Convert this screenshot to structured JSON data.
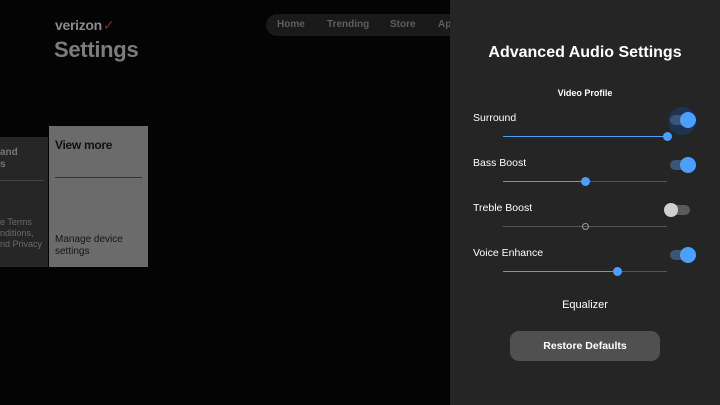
{
  "app": {
    "logo": "verizon",
    "logo_mark": "✓",
    "title": "Settings"
  },
  "nav": {
    "items": [
      "Home",
      "Trending",
      "Store",
      "Ap"
    ]
  },
  "cards": {
    "left_partial": {
      "title": "and\ns",
      "desc": "e Terms\nnditions,\nnd Privacy"
    },
    "view_more": {
      "title": "View more",
      "desc": "Manage device settings"
    }
  },
  "panel": {
    "title": "Advanced Audio Settings",
    "profile": "Video Profile",
    "settings": [
      {
        "label": "Surround",
        "enabled": true,
        "level": 1.0
      },
      {
        "label": "Bass Boost",
        "enabled": true,
        "level": 0.5
      },
      {
        "label": "Treble Boost",
        "enabled": false,
        "level": 0.5
      },
      {
        "label": "Voice Enhance",
        "enabled": true,
        "level": 0.7
      }
    ],
    "equalizer": "Equalizer",
    "restore": "Restore Defaults"
  },
  "colors": {
    "accent": "#4a9fff",
    "panel_bg": "#252525",
    "card_focus": "#6b6b6b"
  }
}
